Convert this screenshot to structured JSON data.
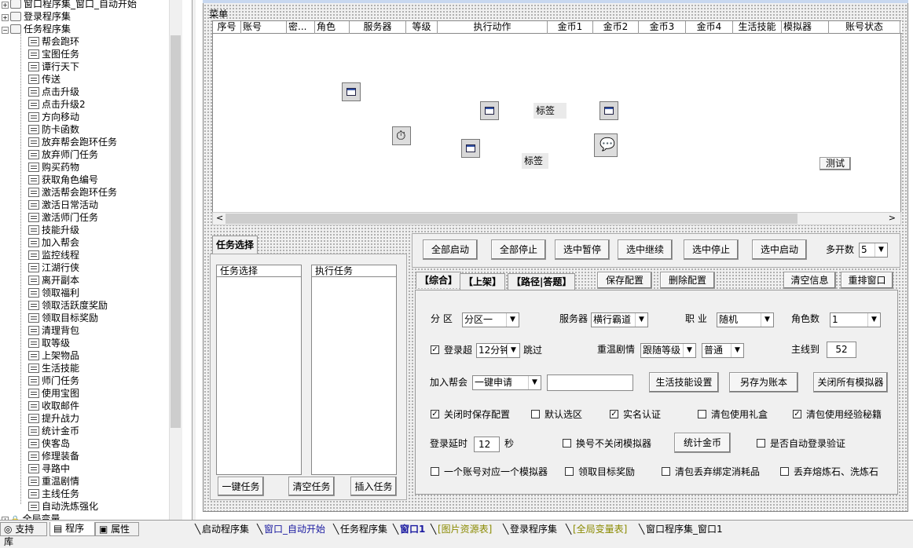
{
  "left_tree": {
    "rows": [
      {
        "label": "窗口程序集_窗口_自动开始",
        "kind": "folder",
        "expanded": false
      },
      {
        "label": "登录程序集",
        "kind": "folder",
        "expanded": false
      },
      {
        "label": "任务程序集",
        "kind": "folder",
        "expanded": true
      },
      {
        "label": "帮会跑环",
        "kind": "item"
      },
      {
        "label": "宝图任务",
        "kind": "item"
      },
      {
        "label": "谭行天下",
        "kind": "item"
      },
      {
        "label": "传送",
        "kind": "item"
      },
      {
        "label": "点击升级",
        "kind": "item"
      },
      {
        "label": "点击升级2",
        "kind": "item"
      },
      {
        "label": "方向移动",
        "kind": "item"
      },
      {
        "label": "防卡函数",
        "kind": "item"
      },
      {
        "label": "放弃帮会跑环任务",
        "kind": "item"
      },
      {
        "label": "放弃师门任务",
        "kind": "item"
      },
      {
        "label": "购买药物",
        "kind": "item"
      },
      {
        "label": "获取角色编号",
        "kind": "item"
      },
      {
        "label": "激活帮会跑环任务",
        "kind": "item"
      },
      {
        "label": "激活日常活动",
        "kind": "item"
      },
      {
        "label": "激活师门任务",
        "kind": "item"
      },
      {
        "label": "技能升级",
        "kind": "item"
      },
      {
        "label": "加入帮会",
        "kind": "item"
      },
      {
        "label": "监控线程",
        "kind": "item"
      },
      {
        "label": "江湖行侠",
        "kind": "item"
      },
      {
        "label": "离开副本",
        "kind": "item"
      },
      {
        "label": "领取福利",
        "kind": "item"
      },
      {
        "label": "领取活跃度奖励",
        "kind": "item"
      },
      {
        "label": "领取目标奖励",
        "kind": "item"
      },
      {
        "label": "清理背包",
        "kind": "item"
      },
      {
        "label": "取等级",
        "kind": "item"
      },
      {
        "label": "上架物品",
        "kind": "item"
      },
      {
        "label": "生活技能",
        "kind": "item"
      },
      {
        "label": "师门任务",
        "kind": "item"
      },
      {
        "label": "使用宝图",
        "kind": "item"
      },
      {
        "label": "收取邮件",
        "kind": "item"
      },
      {
        "label": "提升战力",
        "kind": "item"
      },
      {
        "label": "统计金币",
        "kind": "item"
      },
      {
        "label": "侠客岛",
        "kind": "item"
      },
      {
        "label": "修理装备",
        "kind": "item"
      },
      {
        "label": "寻路中",
        "kind": "item"
      },
      {
        "label": "重温剧情",
        "kind": "item"
      },
      {
        "label": "主线任务",
        "kind": "item"
      },
      {
        "label": "自动洗炼强化",
        "kind": "item"
      },
      {
        "label": "全局变量",
        "kind": "lock"
      }
    ]
  },
  "left_tabs": [
    "支持库",
    "程序",
    "属性"
  ],
  "form": {
    "menu_label": "菜单",
    "grid_columns": [
      "序号",
      "账号",
      "密...",
      "角色",
      "服务器",
      "等级",
      "执行动作",
      "金币1",
      "金币2",
      "金币3",
      "金币4",
      "生活技能",
      "模拟器",
      "账号状态"
    ],
    "label_a": "标签",
    "label_b": "标签",
    "test_button": "测试",
    "task_tab": "任务选择",
    "list_task_header": "任务选择",
    "list_exec_header": "执行任务",
    "btn_one_key": "一键任务",
    "btn_clear_task": "清空任务",
    "btn_insert_task": "插入任务",
    "control_buttons": [
      "全部启动",
      "全部停止",
      "选中暂停",
      "选中继续",
      "选中停止",
      "选中启动"
    ],
    "multi_open_label": "多开数",
    "multi_open_value": "5",
    "settings_tabs": [
      "【综合】",
      "【上架】",
      "【路径|答题】"
    ],
    "btn_save_config": "保存配置",
    "btn_delete_config": "删除配置",
    "btn_clear_info": "清空信息",
    "btn_rearrange": "重排窗口",
    "zone_label": "分 区",
    "zone_value": "分区一",
    "server_label": "服务器",
    "server_value": "横行霸道",
    "job_label": "职  业",
    "job_value": "随机",
    "role_count_label": "角色数",
    "role_count_value": "1",
    "login_timeout_label": "登录超",
    "login_timeout_value": "12分钟",
    "skip_label": "跳过",
    "replay_label": "重温剧情",
    "replay_value1": "跟随等级",
    "replay_value2": "普通",
    "mainline_label": "主线到",
    "mainline_value": "52",
    "join_guild_label": "加入帮会",
    "join_guild_value": "一键申请",
    "btn_life_skill": "生活技能设置",
    "btn_save_as_account": "另存为账本",
    "btn_close_emulators": "关闭所有模拟器",
    "opt_save_on_close": "关闭时保存配置",
    "opt_default_zone": "默认选区",
    "opt_real_name": "实名认证",
    "opt_use_gift": "清包使用礼盒",
    "opt_use_exp_book": "清包使用经验秘籍",
    "login_delay_label": "登录延时",
    "login_delay_value": "12",
    "seconds_label": "秒",
    "opt_keep_emulator": "换号不关闭模拟器",
    "btn_count_gold": "统计金币",
    "opt_auto_login_verify": "是否自动登录验证",
    "opt_one_account_one_emulator": "一个账号对应一个模拟器",
    "opt_claim_goal_reward": "领取目标奖励",
    "opt_discard_bound_items": "清包丢弃绑定消耗品",
    "opt_discard_stones": "丢弃熔炼石、洗炼石",
    "checked": {
      "login_timeout": true,
      "save_on_close": true,
      "default_zone": false,
      "real_name": true,
      "use_gift": false,
      "use_exp_book": true,
      "keep_emulator": false,
      "auto_login_verify": false,
      "one_account_one_emulator": false,
      "claim_goal_reward": false,
      "discard_bound_items": false,
      "discard_stones": false
    }
  },
  "doc_tabs": [
    {
      "label": "启动程序集",
      "color": "#000000"
    },
    {
      "label": "窗口_自动开始",
      "color": "#1a1aa0"
    },
    {
      "label": "任务程序集",
      "color": "#000000"
    },
    {
      "label": "窗口1",
      "color": "#1a1aa0",
      "bold": true
    },
    {
      "label": "[图片资源表]",
      "color": "#8a8a00"
    },
    {
      "label": "登录程序集",
      "color": "#000000"
    },
    {
      "label": "[全局变量表]",
      "color": "#8a8a00"
    },
    {
      "label": "窗口程序集_窗口1",
      "color": "#000000"
    }
  ],
  "colors": {
    "accent": "#3355aa",
    "panel_bg": "#f0f0f0"
  }
}
